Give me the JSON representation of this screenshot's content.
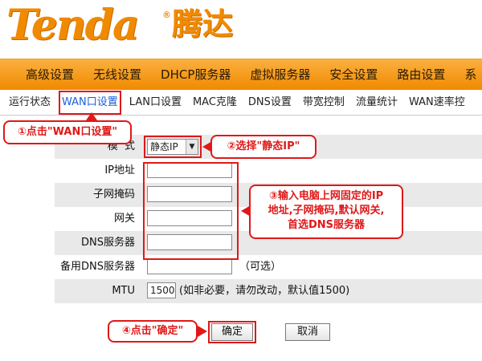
{
  "brand": {
    "logo_text": "Tenda",
    "reg_mark": "®",
    "logo_cn": "腾达"
  },
  "main_nav": [
    "高级设置",
    "无线设置",
    "DHCP服务器",
    "虚拟服务器",
    "安全设置",
    "路由设置",
    "系"
  ],
  "sub_nav": [
    "运行状态",
    "WAN口设置",
    "LAN口设置",
    "MAC克隆",
    "DNS设置",
    "带宽控制",
    "流量统计",
    "WAN速率控"
  ],
  "form": {
    "mode_label": "模  式",
    "mode_value": "静态IP",
    "ip_label": "IP地址",
    "mask_label": "子网掩码",
    "gateway_label": "网关",
    "dns_label": "DNS服务器",
    "alt_dns_label": "备用DNS服务器",
    "alt_dns_note": "（可选）",
    "mtu_label": "MTU",
    "mtu_value": "1500",
    "mtu_note": "(如非必要，请勿改动，默认值1500)"
  },
  "callouts": {
    "step1": "①点击\"WAN口设置\"",
    "step2": "②选择\"静态IP\"",
    "step3_line1": "③输入电脑上网固定的IP",
    "step3_line2": "地址,子网掩码,默认网关,",
    "step3_line3": "首选DNS服务器",
    "step4": "④点击\"确定\""
  },
  "buttons": {
    "ok": "确定",
    "cancel": "取消"
  },
  "colors": {
    "accent": "#f08a00",
    "highlight": "#e01818",
    "link": "#1a5fd8"
  }
}
